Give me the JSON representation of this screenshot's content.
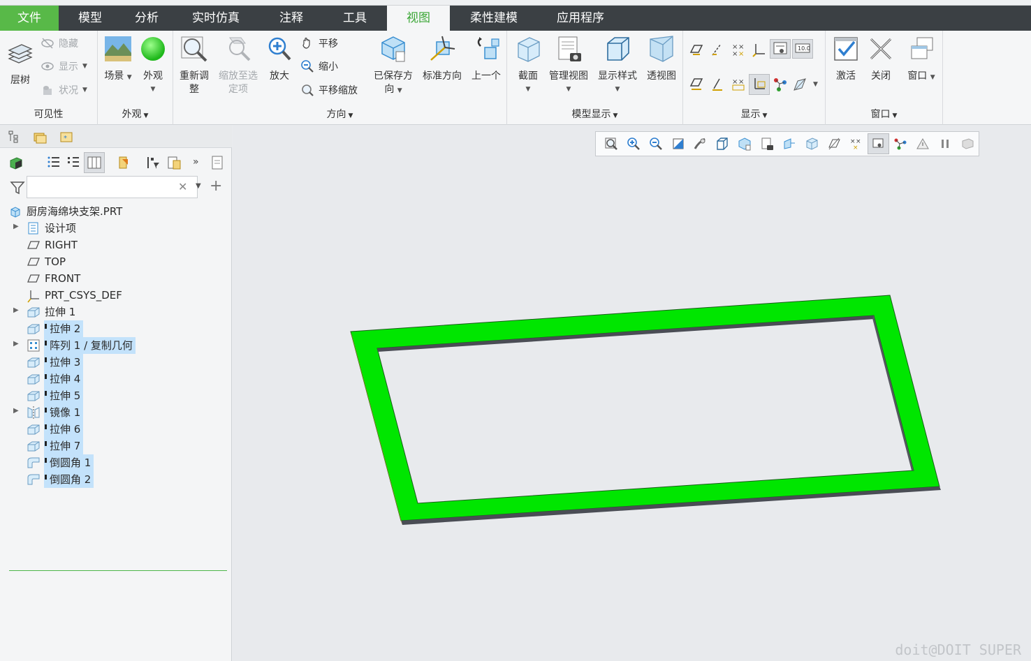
{
  "menubar": {
    "tabs": [
      {
        "label": "文件"
      },
      {
        "label": "模型"
      },
      {
        "label": "分析"
      },
      {
        "label": "实时仿真"
      },
      {
        "label": "注释"
      },
      {
        "label": "工具"
      },
      {
        "label": "视图"
      },
      {
        "label": "柔性建模"
      },
      {
        "label": "应用程序"
      }
    ],
    "active_tab": "视图"
  },
  "ribbon": {
    "visibility": {
      "label": "可见性",
      "layer_tree": "层树",
      "hide": "隐藏",
      "show": "显示",
      "status": "状况"
    },
    "appearance": {
      "label": "外观",
      "scene": "场景",
      "appearance": "外观"
    },
    "orientation": {
      "label": "方向",
      "refit_line1": "重新调",
      "refit_line2": "整",
      "zoom_sel_line1": "缩放至选",
      "zoom_sel_line2": "定项",
      "zoom_in": "放大",
      "pan": "平移",
      "zoom_out": "缩小",
      "pan_zoom": "平移缩放",
      "saved_line1": "已保存方",
      "saved_line2": "向",
      "standard": "标准方向",
      "previous": "上一个"
    },
    "model_display": {
      "label": "模型显示",
      "section": "截面",
      "manage_views": "管理视图",
      "display_style": "显示样式",
      "perspective": "透视图"
    },
    "display": {
      "label": "显示"
    },
    "window": {
      "label": "窗口",
      "activate": "激活",
      "close": "关闭",
      "windows": "窗口"
    }
  },
  "search": {
    "value": "",
    "placeholder": ""
  },
  "tree": {
    "root": "厨房海绵块支架.PRT",
    "items": [
      {
        "label": "设计项",
        "expandable": true,
        "selected": false,
        "icon": "design-items-icon"
      },
      {
        "label": "RIGHT",
        "expandable": false,
        "selected": false,
        "icon": "datum-plane-icon"
      },
      {
        "label": "TOP",
        "expandable": false,
        "selected": false,
        "icon": "datum-plane-icon"
      },
      {
        "label": "FRONT",
        "expandable": false,
        "selected": false,
        "icon": "datum-plane-icon"
      },
      {
        "label": "PRT_CSYS_DEF",
        "expandable": false,
        "selected": false,
        "icon": "csys-icon"
      },
      {
        "label": "拉伸 1",
        "expandable": true,
        "selected": false,
        "icon": "extrude-icon"
      },
      {
        "label": "拉伸 2",
        "expandable": false,
        "selected": true,
        "icon": "extrude-icon"
      },
      {
        "label": "阵列 1 / 复制几何",
        "expandable": true,
        "selected": true,
        "icon": "pattern-icon"
      },
      {
        "label": "拉伸 3",
        "expandable": false,
        "selected": true,
        "icon": "extrude-icon"
      },
      {
        "label": "拉伸 4",
        "expandable": false,
        "selected": true,
        "icon": "extrude-icon"
      },
      {
        "label": "拉伸 5",
        "expandable": false,
        "selected": true,
        "icon": "extrude-icon"
      },
      {
        "label": "镜像 1",
        "expandable": true,
        "selected": true,
        "icon": "mirror-icon"
      },
      {
        "label": "拉伸 6",
        "expandable": false,
        "selected": true,
        "icon": "extrude-icon"
      },
      {
        "label": "拉伸 7",
        "expandable": false,
        "selected": true,
        "icon": "extrude-icon"
      },
      {
        "label": "倒圆角 1",
        "expandable": false,
        "selected": true,
        "icon": "round-icon"
      },
      {
        "label": "倒圆角 2",
        "expandable": false,
        "selected": true,
        "icon": "round-icon"
      }
    ]
  },
  "viewport": {
    "watermark": "doit@DOIT SUPER",
    "model_color": "#00e600"
  },
  "colors": {
    "accent": "#58b948",
    "menubar_bg": "#3b4044",
    "selection": "#c3e2fb"
  }
}
